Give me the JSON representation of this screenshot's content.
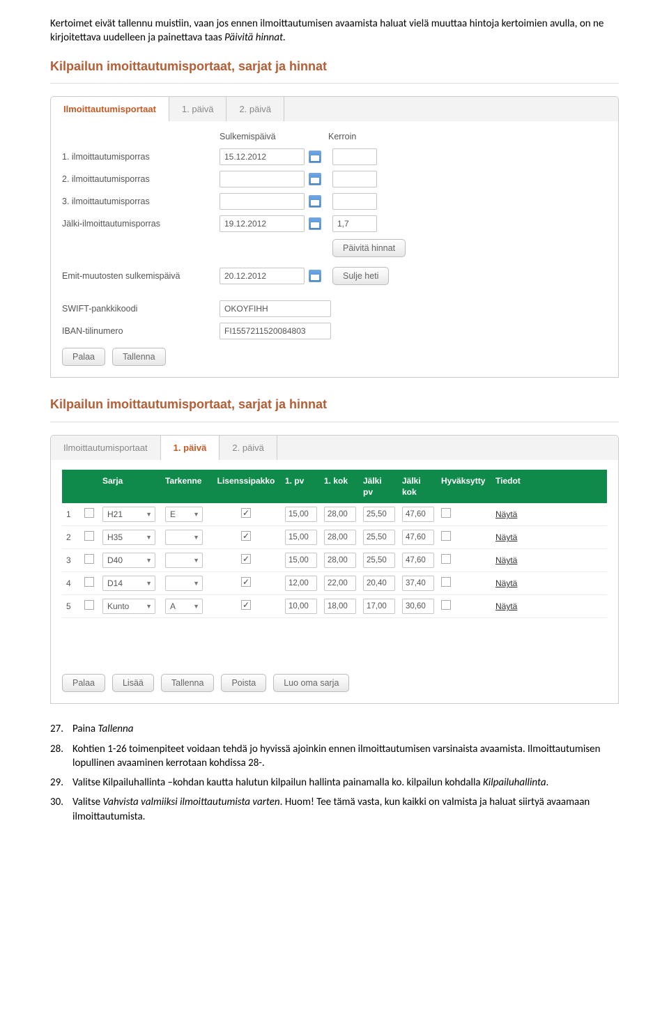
{
  "intro_text": "Kertoimet eivät tallennu muistiin, vaan jos ennen ilmoittautumisen avaamista haluat vielä muuttaa hintoja kertoimien avulla, on ne kirjoitettava uudelleen ja painettava taas ",
  "intro_italic": "Päivitä hinnat.",
  "shot1": {
    "title": "Kilpailun imoittautumisportaat, sarjat ja hinnat",
    "tabs": {
      "t1": "Ilmoittautumisportaat",
      "t2": "1. päivä",
      "t3": "2. päivä"
    },
    "headers": {
      "h1": "Sulkemispäivä",
      "h2": "Kerroin"
    },
    "rows": [
      {
        "label": "1. ilmoittautumisporras",
        "date": "15.12.2012",
        "kerroin": ""
      },
      {
        "label": "2. ilmoittautumisporras",
        "date": "",
        "kerroin": ""
      },
      {
        "label": "3. ilmoittautumisporras",
        "date": "",
        "kerroin": ""
      },
      {
        "label": "Jälki-ilmoittautumisporras",
        "date": "19.12.2012",
        "kerroin": "1,7"
      }
    ],
    "btn_update": "Päivitä hinnat",
    "emit_label": "Emit-muutosten sulkemispäivä",
    "emit_date": "20.12.2012",
    "btn_close_now": "Sulje heti",
    "swift_label": "SWIFT-pankkikoodi",
    "swift_value": "OKOYFIHH",
    "iban_label": "IBAN-tilinumero",
    "iban_value": "FI1557211520084803",
    "btn_back": "Palaa",
    "btn_save": "Tallenna"
  },
  "shot2": {
    "title": "Kilpailun imoittautumisportaat, sarjat ja hinnat",
    "tabs": {
      "t1": "Ilmoittautumisportaat",
      "t2": "1. päivä",
      "t3": "2. päivä"
    },
    "thead": {
      "sarja": "Sarja",
      "tarkenne": "Tarkenne",
      "lisenssi": "Lisenssipakko",
      "pv1": "1. pv",
      "kok1": "1. kok",
      "jpv": "Jälki pv",
      "jkok": "Jälki kok",
      "hyv": "Hyväksytty",
      "tiedot": "Tiedot"
    },
    "rows": [
      {
        "n": "1",
        "sarja": "H21",
        "tark": "E",
        "lis": true,
        "pv1": "15,00",
        "kok1": "28,00",
        "jpv": "25,50",
        "jkok": "47,60",
        "hyv": false,
        "link": "Näytä"
      },
      {
        "n": "2",
        "sarja": "H35",
        "tark": "",
        "lis": true,
        "pv1": "15,00",
        "kok1": "28,00",
        "jpv": "25,50",
        "jkok": "47,60",
        "hyv": false,
        "link": "Näytä"
      },
      {
        "n": "3",
        "sarja": "D40",
        "tark": "",
        "lis": true,
        "pv1": "15,00",
        "kok1": "28,00",
        "jpv": "25,50",
        "jkok": "47,60",
        "hyv": false,
        "link": "Näytä"
      },
      {
        "n": "4",
        "sarja": "D14",
        "tark": "",
        "lis": true,
        "pv1": "12,00",
        "kok1": "22,00",
        "jpv": "20,40",
        "jkok": "37,40",
        "hyv": false,
        "link": "Näytä"
      },
      {
        "n": "5",
        "sarja": "Kunto",
        "tark": "A",
        "lis": true,
        "pv1": "10,00",
        "kok1": "18,00",
        "jpv": "17,00",
        "jkok": "30,60",
        "hyv": false,
        "link": "Näytä"
      }
    ],
    "btns": {
      "back": "Palaa",
      "add": "Lisää",
      "save": "Tallenna",
      "del": "Poista",
      "own": "Luo oma sarja"
    }
  },
  "steps": {
    "s27_num": "27.",
    "s27_a": "Paina ",
    "s27_b": "Tallenna",
    "s28_num": "28.",
    "s28": "Kohtien 1-26 toimenpiteet voidaan tehdä jo hyvissä ajoinkin ennen ilmoittautumisen varsinaista avaamista. Ilmoittautumisen lopullinen avaaminen kerrotaan kohdissa 28-.",
    "s29_num": "29.",
    "s29_a": "Valitse Kilpailuhallinta –kohdan kautta halutun kilpailun hallinta painamalla ko. kilpailun kohdalla ",
    "s29_b": "Kilpailuhallinta",
    "s29_c": ".",
    "s30_num": "30.",
    "s30_a": "Valitse ",
    "s30_b": "Vahvista valmiiksi ilmoittautumista varten",
    "s30_c": ".  Huom! Tee tämä vasta, kun kaikki on valmista ja haluat siirtyä avaamaan ilmoittautumista."
  }
}
